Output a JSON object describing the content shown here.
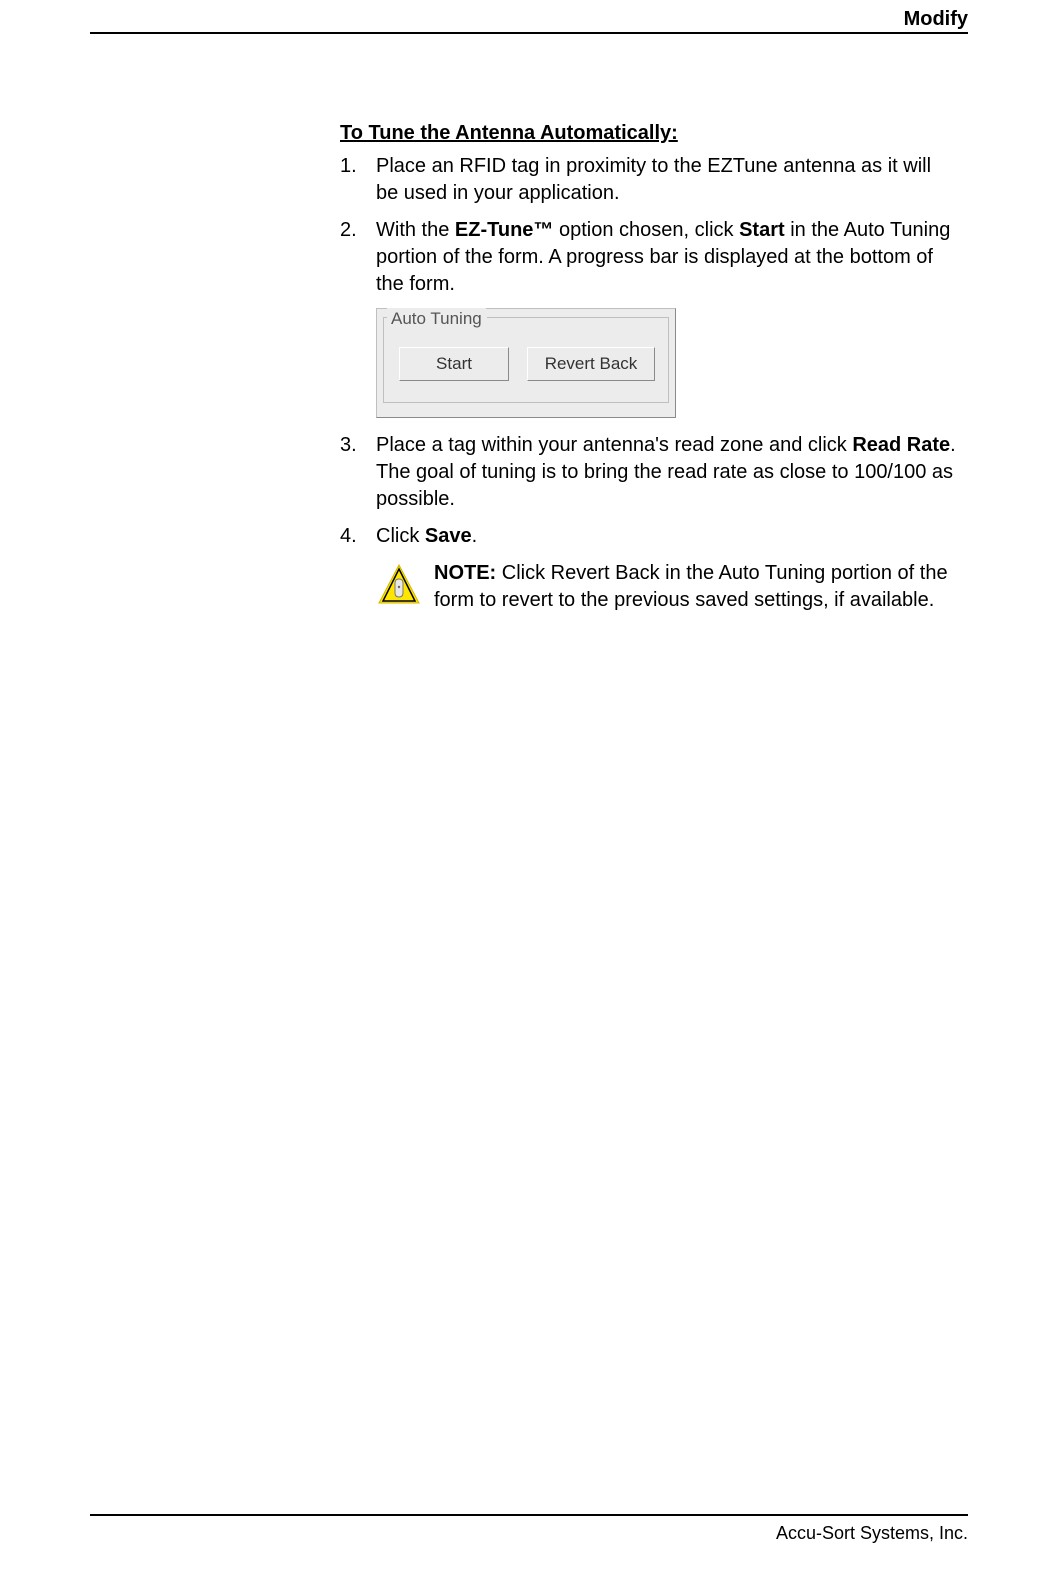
{
  "header": {
    "section": "Modify"
  },
  "section": {
    "title": "To Tune the Antenna Automatically:",
    "steps": [
      {
        "num": "1.",
        "parts": [
          {
            "t": "Place an RFID tag in proximity to the EZTune antenna as it will be used in your application."
          }
        ]
      },
      {
        "num": "2.",
        "parts": [
          {
            "t": "With the "
          },
          {
            "t": "EZ-Tune™",
            "b": true
          },
          {
            "t": " option chosen, click "
          },
          {
            "t": "Start",
            "b": true
          },
          {
            "t": " in the Auto Tuning portion of the form. A progress bar is displayed at the bottom of the form."
          }
        ]
      },
      {
        "num": "3.",
        "parts": [
          {
            "t": "Place a tag within your antenna's read zone and click "
          },
          {
            "t": "Read Rate",
            "b": true
          },
          {
            "t": ". The goal of tuning is to bring the read rate as close to 100/100 as possible."
          }
        ]
      },
      {
        "num": "4.",
        "parts": [
          {
            "t": "Click "
          },
          {
            "t": "Save",
            "b": true
          },
          {
            "t": "."
          }
        ]
      }
    ]
  },
  "figure": {
    "legend": "Auto Tuning",
    "buttons": {
      "start": "Start",
      "revert": "Revert Back"
    }
  },
  "note": {
    "label": "NOTE:",
    "text": " Click Revert Back in the Auto Tuning portion of the form to revert to the previous saved settings, if available."
  },
  "footer": {
    "company": "Accu-Sort Systems, Inc."
  }
}
